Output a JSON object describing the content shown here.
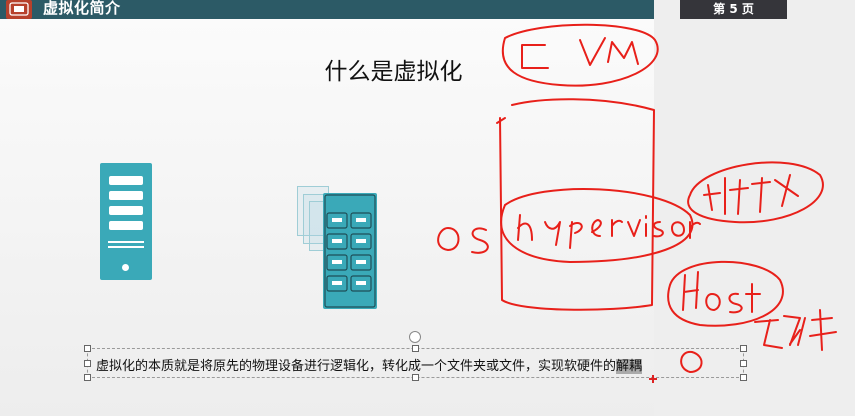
{
  "header": {
    "title": "虚拟化简介",
    "logo_icon": "logo-icon"
  },
  "page_badge": "第 5 页",
  "slide": {
    "title": "什么是虚拟化",
    "caption_main": "虚拟化的本质就是将原先的物理设备进行逻辑化，转化成一个文件夹或文件，实现软硬件的",
    "caption_highlight": "解耦",
    "icons": [
      "server-icon",
      "virtualized-server-icon"
    ]
  },
  "colors": {
    "header": "#2c5a66",
    "accent": "#3aa9b8",
    "ink": "#e8201a",
    "badge": "#35353a"
  }
}
